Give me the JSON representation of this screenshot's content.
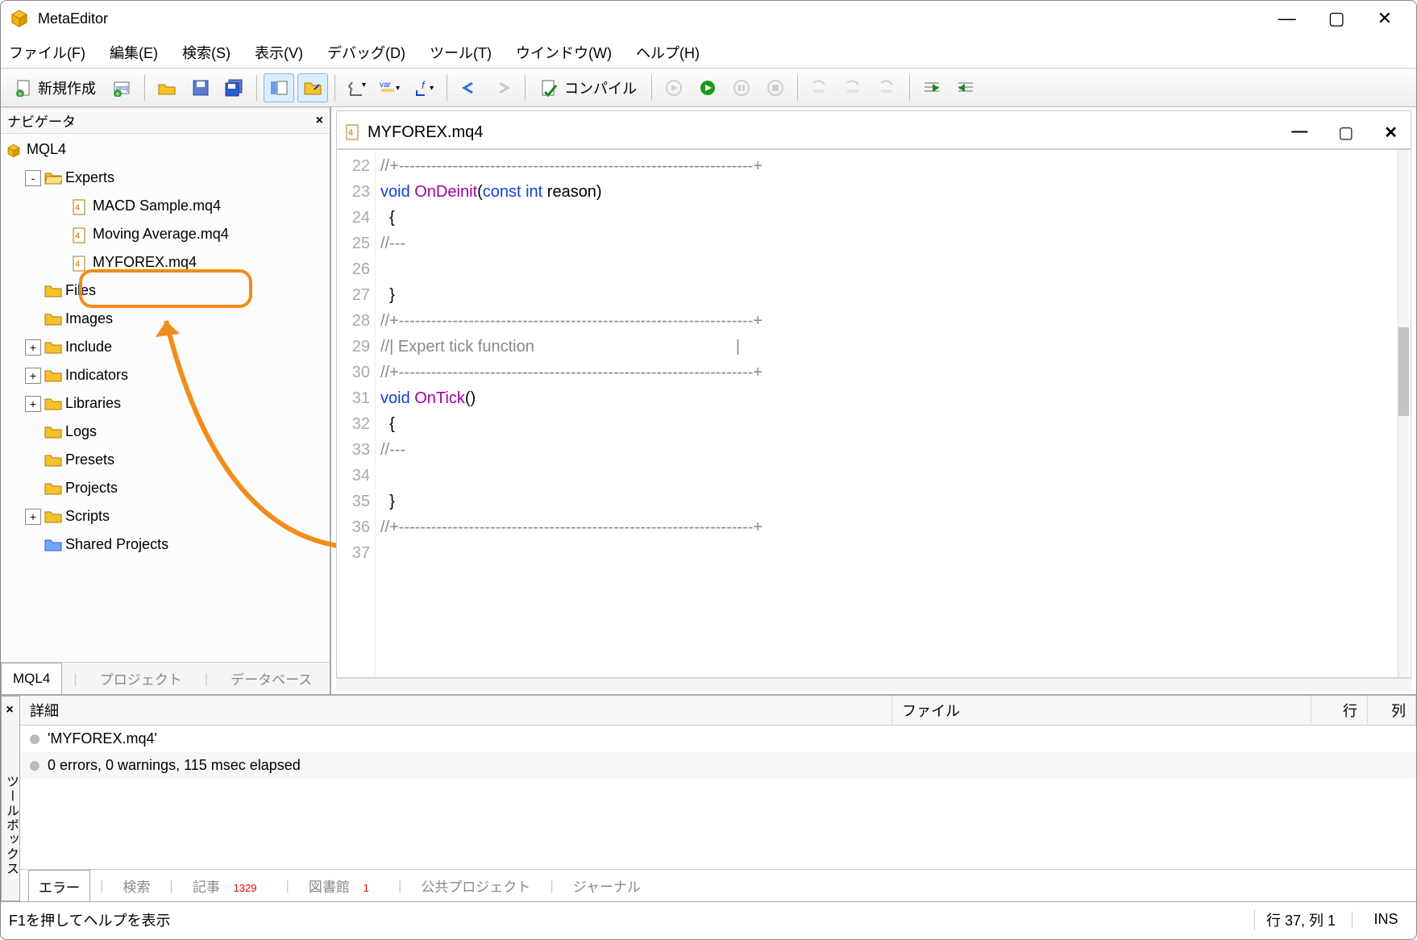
{
  "title": "MetaEditor",
  "menu": [
    "ファイル(F)",
    "編集(E)",
    "検索(S)",
    "表示(V)",
    "デバッグ(D)",
    "ツール(T)",
    "ウインドウ(W)",
    "ヘルプ(H)"
  ],
  "toolbar": {
    "new": "新規作成",
    "compile": "コンパイル"
  },
  "nav": {
    "title": "ナビゲータ",
    "root": "MQL4",
    "items": [
      {
        "t": "Experts",
        "d": 1,
        "tw": "-",
        "ic": "folder-open"
      },
      {
        "t": "MACD Sample.mq4",
        "d": 2,
        "ic": "mq4"
      },
      {
        "t": "Moving Average.mq4",
        "d": 2,
        "ic": "mq4",
        "obsc": true
      },
      {
        "t": "MYFOREX.mq4",
        "d": 2,
        "ic": "mq4",
        "hl": true
      },
      {
        "t": "Files",
        "d": 1,
        "ic": "folder",
        "obscTop": true
      },
      {
        "t": "Images",
        "d": 1,
        "ic": "folder"
      },
      {
        "t": "Include",
        "d": 1,
        "tw": "+",
        "ic": "folder"
      },
      {
        "t": "Indicators",
        "d": 1,
        "tw": "+",
        "ic": "folder"
      },
      {
        "t": "Libraries",
        "d": 1,
        "tw": "+",
        "ic": "folder"
      },
      {
        "t": "Logs",
        "d": 1,
        "ic": "folder"
      },
      {
        "t": "Presets",
        "d": 1,
        "ic": "folder"
      },
      {
        "t": "Projects",
        "d": 1,
        "ic": "folder"
      },
      {
        "t": "Scripts",
        "d": 1,
        "tw": "+",
        "ic": "folder"
      },
      {
        "t": "Shared Projects",
        "d": 1,
        "ic": "folder-blue"
      }
    ],
    "tabs": [
      "MQL4",
      "プロジェクト",
      "データベース"
    ]
  },
  "editor": {
    "file": "MYFOREX.mq4",
    "lines": [
      {
        "n": 22,
        "seg": [
          {
            "c": "cm",
            "t": "//+------------------------------------------------------------------+"
          }
        ]
      },
      {
        "n": 23,
        "seg": [
          {
            "c": "kw",
            "t": "void "
          },
          {
            "c": "fn",
            "t": "OnDeinit"
          },
          {
            "t": "("
          },
          {
            "c": "kw",
            "t": "const int "
          },
          {
            "t": "reason)"
          }
        ]
      },
      {
        "n": 24,
        "seg": [
          {
            "t": "  {"
          }
        ]
      },
      {
        "n": 25,
        "seg": [
          {
            "c": "cm",
            "t": "//---"
          }
        ]
      },
      {
        "n": 26,
        "seg": [
          {
            "t": ""
          }
        ]
      },
      {
        "n": 27,
        "seg": [
          {
            "t": "  }"
          }
        ]
      },
      {
        "n": 28,
        "seg": [
          {
            "c": "cm",
            "t": "//+------------------------------------------------------------------+"
          }
        ]
      },
      {
        "n": 29,
        "seg": [
          {
            "c": "cm",
            "t": "//| Expert tick function                                             |"
          }
        ]
      },
      {
        "n": 30,
        "seg": [
          {
            "c": "cm",
            "t": "//+------------------------------------------------------------------+"
          }
        ]
      },
      {
        "n": 31,
        "seg": [
          {
            "c": "kw",
            "t": "void "
          },
          {
            "c": "fn",
            "t": "OnTick"
          },
          {
            "t": "()"
          }
        ]
      },
      {
        "n": 32,
        "seg": [
          {
            "t": "  {"
          }
        ]
      },
      {
        "n": 33,
        "seg": [
          {
            "c": "cm",
            "t": "//---"
          }
        ]
      },
      {
        "n": 34,
        "seg": [
          {
            "t": ""
          }
        ]
      },
      {
        "n": 35,
        "seg": [
          {
            "t": "  }"
          }
        ]
      },
      {
        "n": 36,
        "seg": [
          {
            "c": "cm",
            "t": "//+------------------------------------------------------------------+"
          }
        ]
      },
      {
        "n": 37,
        "seg": [
          {
            "t": ""
          }
        ]
      }
    ]
  },
  "toolbox": {
    "label": "ツールボックス",
    "cols": [
      "詳細",
      "ファイル",
      "行",
      "列"
    ],
    "rows": [
      "'MYFOREX.mq4'",
      "0 errors, 0 warnings, 115 msec elapsed"
    ],
    "tabs": [
      {
        "t": "エラー"
      },
      {
        "t": "検索"
      },
      {
        "t": "記事",
        "b": "1329"
      },
      {
        "t": "図書館",
        "b": "1"
      },
      {
        "t": "公共プロジェクト"
      },
      {
        "t": "ジャーナル"
      }
    ]
  },
  "status": {
    "help": "F1を押してヘルプを表示",
    "pos": "行 37, 列 1",
    "ins": "INS"
  }
}
